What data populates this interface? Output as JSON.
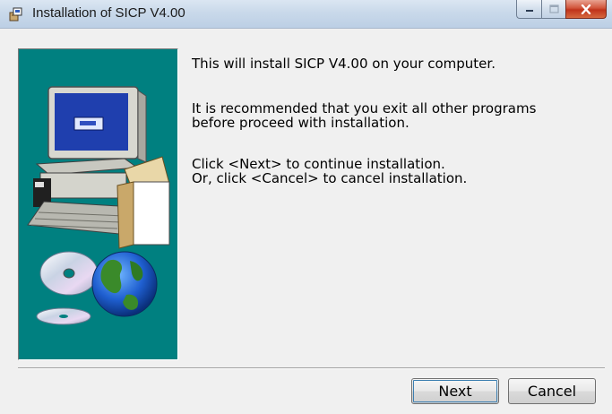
{
  "window": {
    "title": "Installation of SICP V4.00",
    "icons": {
      "app": "installer-icon",
      "minimize": "minimize-icon",
      "maximize": "maximize-icon",
      "close": "close-icon"
    }
  },
  "messages": {
    "line1": "This will install SICP V4.00 on your computer.",
    "line2": "It is recommended that you exit all other programs\nbefore proceed with installation.",
    "line3": "Click <Next> to continue installation.\nOr, click <Cancel> to cancel installation."
  },
  "buttons": {
    "next": "Next",
    "cancel": "Cancel"
  },
  "colors": {
    "side_panel": "#008080",
    "titlebar": "#c9d9ea",
    "close_button": "#c9412a"
  }
}
